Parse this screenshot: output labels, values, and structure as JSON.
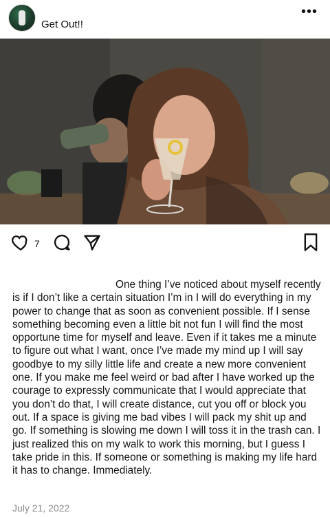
{
  "post": {
    "username": "Get Out!!",
    "more_icon": "more-options-icon",
    "photo_description_icon": "photo",
    "like_count": "7",
    "caption": "One thing I’ve noticed about myself recently is if I don’t like a certain situation I’m in I will do everything in my power to change that as soon as convenient possible. If I sense something becoming even a little bit not fun I will find the most opportune time for myself and leave. Even if it takes me a minute to figure out what I want, once I’ve made my mind up I will say goodbye to my silly little life and create a new more convenient one. If you make me feel weird or bad after I have worked up the courage to expressly communicate that I would appreciate that you don’t do that, I will create distance, cut you off or block you out. If a space is giving me bad vibes I will pack my shit up and go. If something is slowing me down I will toss it in the trash can. I just realized this on my walk to work this morning, but I guess I take pride in this. If someone or something is making my life hard it has to change. Immediately.",
    "date": "July 21, 2022"
  }
}
